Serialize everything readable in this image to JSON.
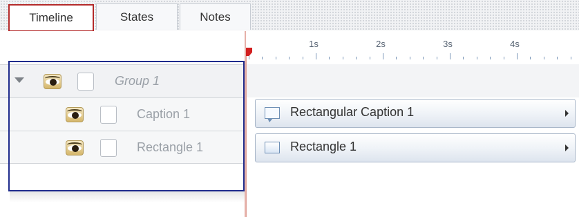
{
  "tabs": [
    {
      "label": "Timeline",
      "active": true
    },
    {
      "label": "States",
      "active": false
    },
    {
      "label": "Notes",
      "active": false
    }
  ],
  "layers": {
    "group": {
      "name": "Group 1",
      "expanded": true,
      "visible": true,
      "locked": false
    },
    "items": [
      {
        "name": "Caption 1",
        "visible": true,
        "locked": false
      },
      {
        "name": "Rectangle 1",
        "visible": true,
        "locked": false
      }
    ]
  },
  "ruler": {
    "labels": [
      "1s",
      "2s",
      "3s",
      "4s"
    ],
    "playhead_time": 0
  },
  "tracks": [
    {
      "label": "Rectangular Caption 1",
      "icon": "caption-icon"
    },
    {
      "label": "Rectangle 1",
      "icon": "rectangle-icon"
    }
  ],
  "colors": {
    "active_tab_outline": "#b42a2a",
    "selection_outline": "#1e2b8c",
    "playhead": "#d21f1f"
  }
}
